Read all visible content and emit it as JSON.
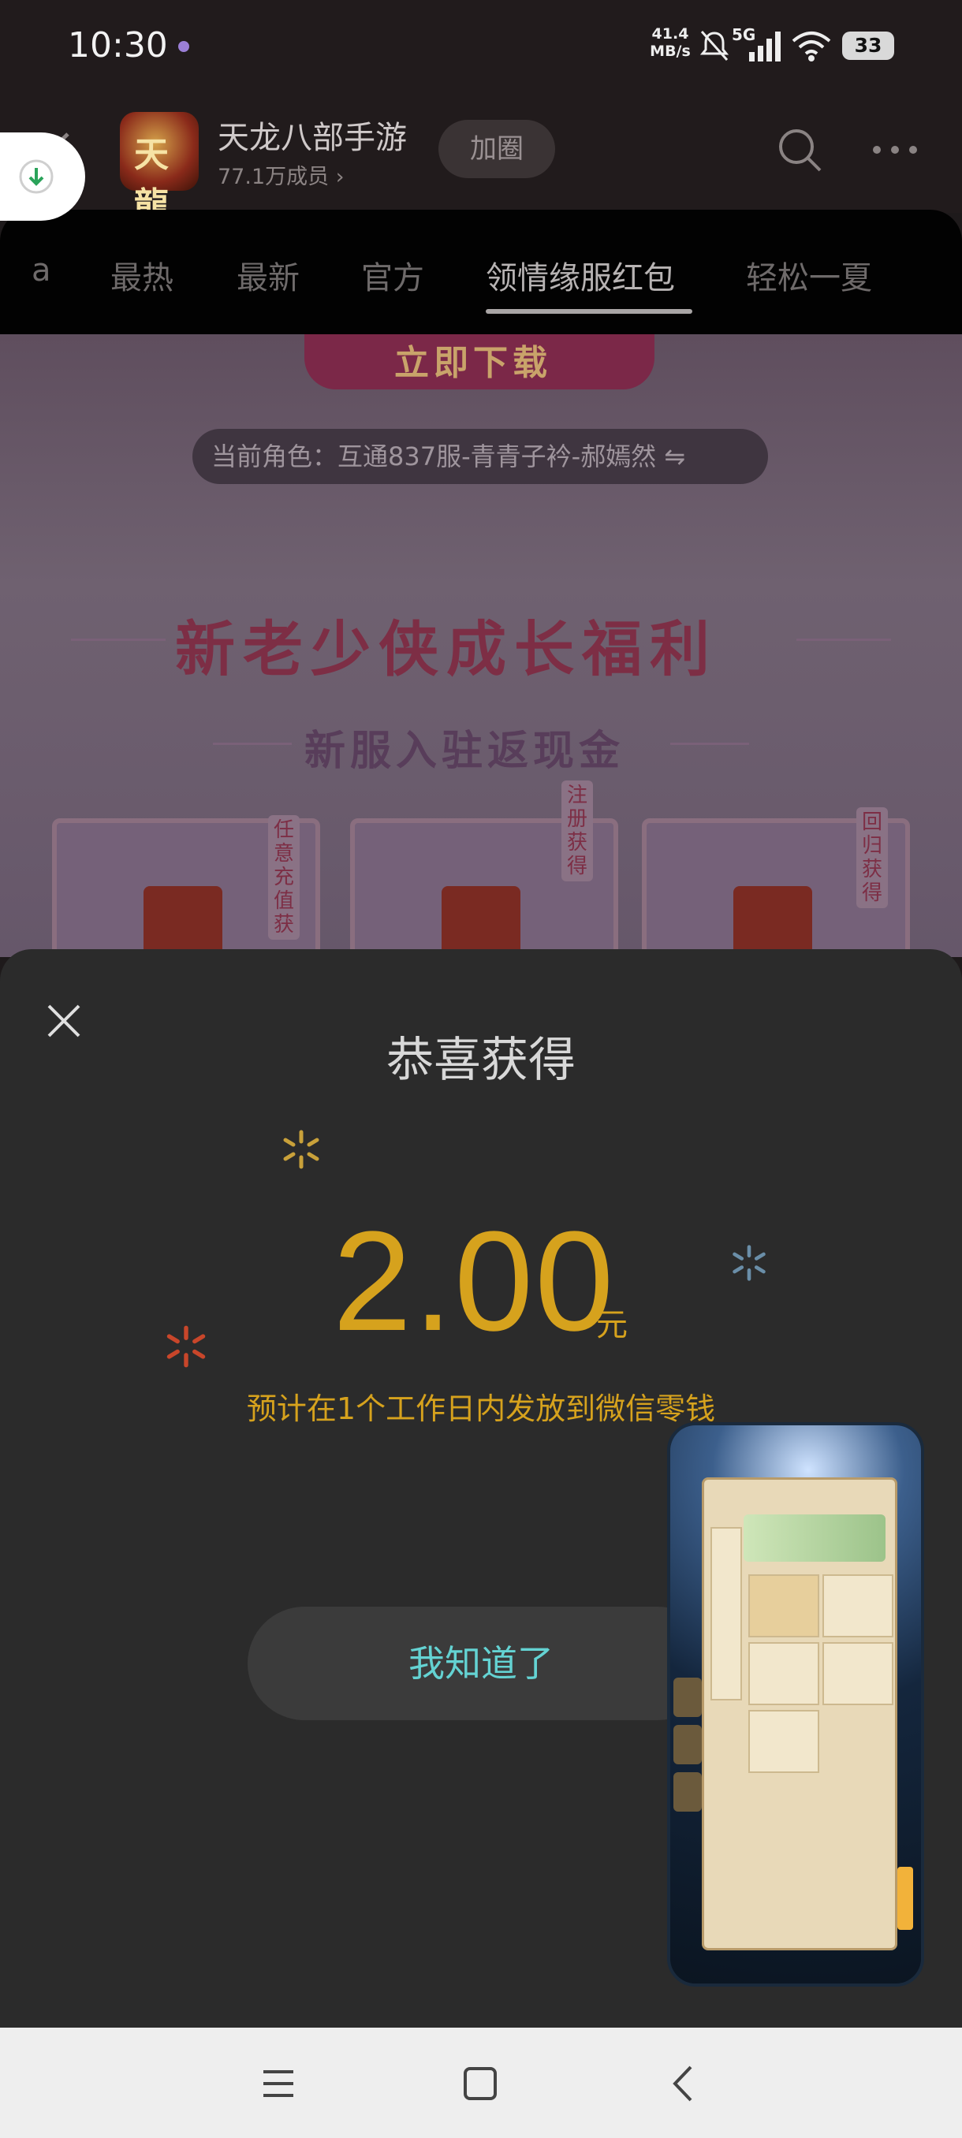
{
  "status_bar": {
    "time": "10:30",
    "net_speed_value": "41.4",
    "net_speed_unit": "MB/s",
    "network": "5G",
    "battery": "33"
  },
  "header": {
    "app_name": "天龙八部手游",
    "logo_text": "天龍",
    "members": "77.1万成员",
    "join_label": "加圈"
  },
  "tabs": {
    "items": [
      {
        "label": "a"
      },
      {
        "label": "最热"
      },
      {
        "label": "最新"
      },
      {
        "label": "官方"
      },
      {
        "label": "领情缘服红包"
      },
      {
        "label": "轻松一夏"
      }
    ],
    "active_index": 4
  },
  "page": {
    "download_banner": "立即下载",
    "current_role": "当前角色：互通837服-青青子衿-郝嫣然 ⇋",
    "promo_title": "新老少侠成长福利",
    "promo_subtitle": "新服入驻返现金",
    "card_tags": [
      "任意充值获",
      "注册获得",
      "回归获得"
    ]
  },
  "modal": {
    "title": "恭喜获得",
    "amount": "2.00",
    "currency": "元",
    "note": "预计在1个工作日内发放到微信零钱",
    "confirm_label": "我知道了"
  },
  "colors": {
    "accent_gold": "#d6a21d",
    "button_text_cyan": "#64d3d3",
    "sheet_bg": "#2b2b2b"
  }
}
